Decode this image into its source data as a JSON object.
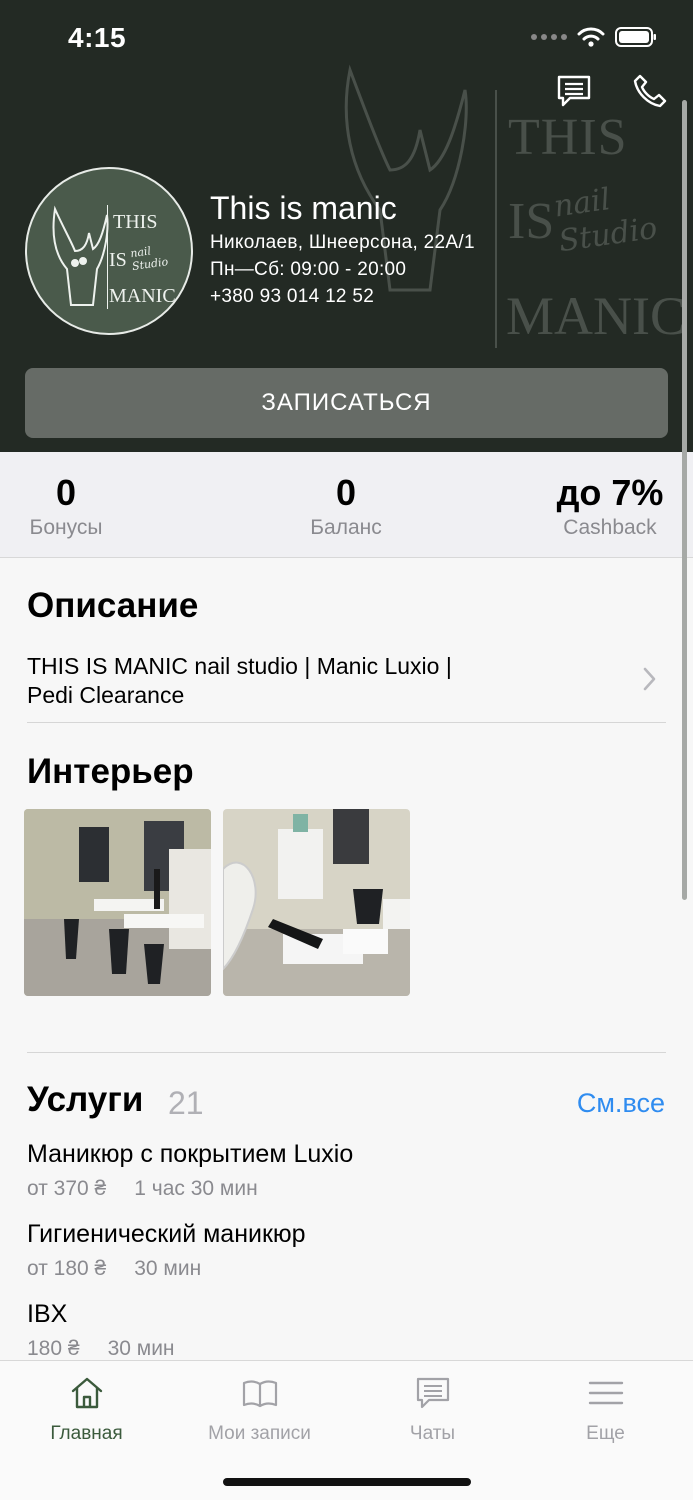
{
  "status": {
    "time": "4:15"
  },
  "header": {
    "salon_name": "This is manic",
    "address": "Николаев, Шнеерсона, 22А/1",
    "hours": "Пн—Сб: 09:00 - 20:00",
    "phone": "+380 93 014 12 52",
    "book_label": "ЗАПИСАТЬСЯ",
    "logo_text": {
      "this": "THIS",
      "is": "IS",
      "nail": "nail Studio",
      "manic": "MANIC"
    }
  },
  "stats": [
    {
      "value": "0",
      "label": "Бонусы"
    },
    {
      "value": "0",
      "label": "Баланс"
    },
    {
      "value": "до 7%",
      "label": "Cashback"
    }
  ],
  "description": {
    "title": "Описание",
    "line1": "THIS IS MANIC nail studio | Manic Luxio |",
    "line2": "Pedi Clearance"
  },
  "interior": {
    "title": "Интерьер"
  },
  "services": {
    "title": "Услуги",
    "count": "21",
    "see_all": "См.все",
    "items": [
      {
        "name": "Маникюр с покрытием Luxio",
        "price": "от 370 ₴",
        "duration": "1 час 30 мин"
      },
      {
        "name": "Гигиенический  маникюр",
        "price": "от 180 ₴",
        "duration": "30 мин"
      },
      {
        "name": "IBX",
        "price": "180 ₴",
        "duration": "30 мин"
      }
    ]
  },
  "tabs": [
    {
      "label": "Главная",
      "icon": "home-icon"
    },
    {
      "label": "Мои записи",
      "icon": "book-icon"
    },
    {
      "label": "Чаты",
      "icon": "chat-icon"
    },
    {
      "label": "Еще",
      "icon": "menu-icon"
    }
  ],
  "colors": {
    "header_bg": "#232a24",
    "accent_active": "#3b5a3c",
    "link": "#2f8cf0",
    "button": "#666b66"
  }
}
